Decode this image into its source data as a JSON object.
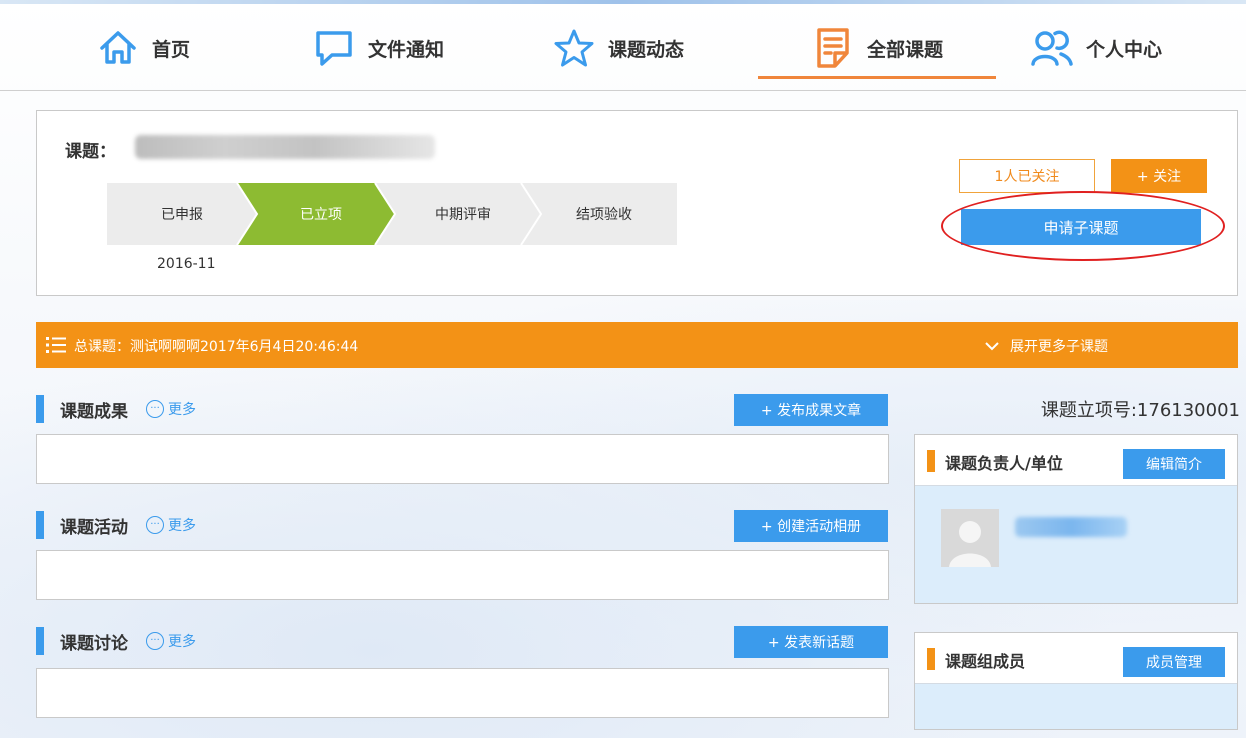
{
  "nav": {
    "items": [
      {
        "label": "首页",
        "icon": "home-icon"
      },
      {
        "label": "文件通知",
        "icon": "chat-icon"
      },
      {
        "label": "课题动态",
        "icon": "star-icon"
      },
      {
        "label": "全部课题",
        "icon": "document-icon",
        "active": true
      },
      {
        "label": "个人中心",
        "icon": "users-icon"
      }
    ]
  },
  "project": {
    "title_label": "课题：",
    "steps": [
      "已申报",
      "已立项",
      "中期评审",
      "结项验收"
    ],
    "active_step": 1,
    "date": "2016-11",
    "follow_count": "1人已关注",
    "follow_button": "+ 关注",
    "apply_button": "申请子课题"
  },
  "parent": {
    "text": "总课题：测试啊啊啊2017年6月4日20:46:44",
    "expand": "展开更多子课题"
  },
  "sections": [
    {
      "title": "课题成果",
      "more": "更多",
      "button": "+ 发布成果文章"
    },
    {
      "title": "课题活动",
      "more": "更多",
      "button": "+ 创建活动相册"
    },
    {
      "title": "课题讨论",
      "more": "更多",
      "button": "+ 发表新话题"
    }
  ],
  "right": {
    "project_no": "课题立项号:176130001",
    "leader_title": "课题负责人/单位",
    "leader_button": "编辑简介",
    "members_title": "课题组成员",
    "members_button": "成员管理"
  },
  "colors": {
    "accent_blue": "#3b9bec",
    "accent_orange": "#f39216",
    "active_step": "#8dbb32"
  }
}
